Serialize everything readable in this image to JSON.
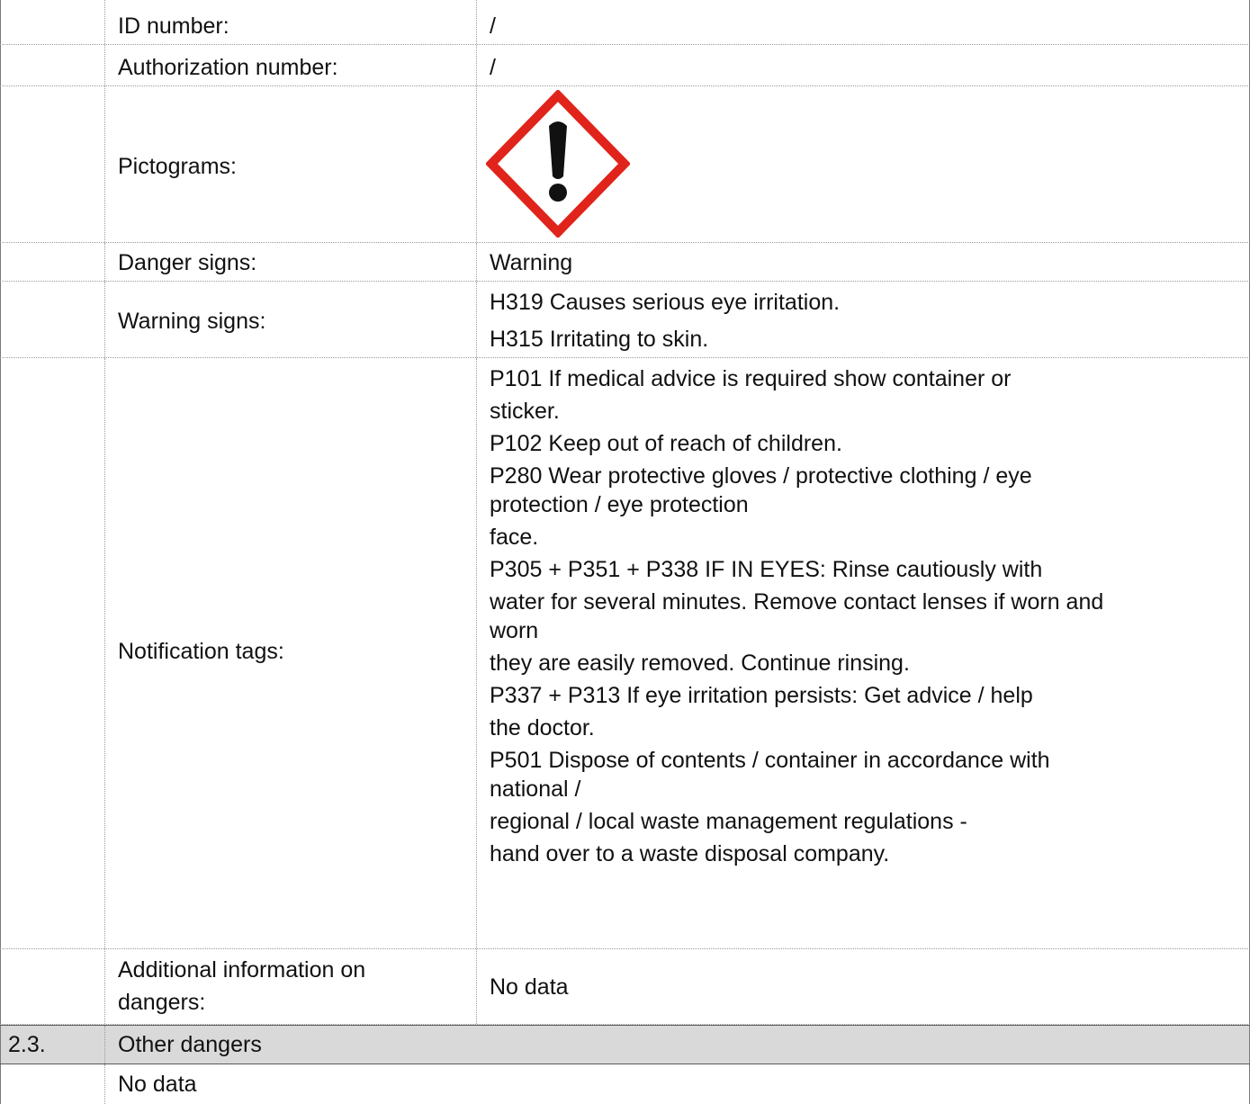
{
  "rows": {
    "id_number": {
      "label": "ID number:",
      "value": "/"
    },
    "authorization_number": {
      "label": "Authorization number:",
      "value": "/"
    },
    "pictograms": {
      "label": "Pictograms:",
      "icon": "ghs07-exclamation-mark-pictogram",
      "border_color": "#e0241b"
    },
    "danger_signs": {
      "label": "Danger signs:",
      "value": "Warning"
    },
    "warning_signs": {
      "label": "Warning signs:",
      "lines": [
        "H319 Causes serious eye irritation.",
        "H315 Irritating to skin."
      ]
    },
    "notification_tags": {
      "label": "Notification tags:",
      "lines": [
        "P101  If medical advice is required show container or",
        "sticker.",
        "P102 Keep out of reach of children.",
        "P280 Wear protective gloves / protective clothing / eye",
        "protection / eye protection",
        "face.",
        "P305 + P351 + P338 IF IN EYES: Rinse cautiously with",
        "water for several minutes. Remove contact lenses if worn and",
        "worn",
        "they are easily removed. Continue rinsing.",
        "P337 + P313 If eye irritation persists: Get advice / help",
        "the doctor.",
        "P501 Dispose of contents / container in accordance with",
        "national /",
        "regional / local waste management regulations -",
        "hand over to a waste disposal company."
      ]
    },
    "additional_info": {
      "label_line1": "Additional information on",
      "label_line2": "dangers:",
      "value": "No data"
    }
  },
  "section": {
    "number": "2.3.",
    "title": "Other dangers",
    "content": "No data"
  },
  "colors": {
    "section_background": "#d9d9d9",
    "pictogram_red": "#e0241b"
  }
}
